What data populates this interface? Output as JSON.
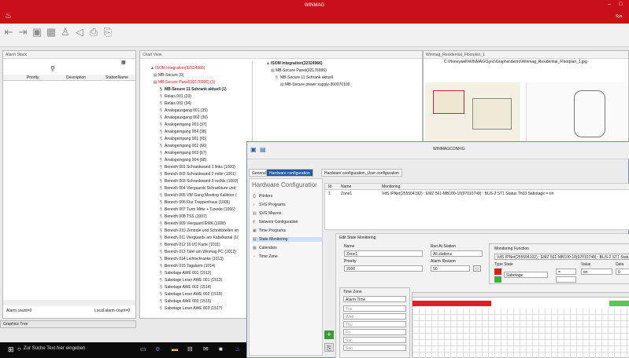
{
  "main": {
    "title": "WINMAG",
    "user": "Sys"
  },
  "alarm_stack": {
    "title": "Alarm Stack",
    "columns": [
      "Priority",
      "Description",
      "StationName"
    ],
    "status_left": "Alarm count=0",
    "status_right": "Local alarm count=0",
    "bottom_tab": "Graphics Tree"
  },
  "chart_view": {
    "title": "Chart View",
    "tree": [
      {
        "label": "ISOM Integration(32324966)",
        "style": "red"
      },
      {
        "label": "MB-Secure (0)",
        "style": ""
      },
      {
        "label": "MB-Secure Panel(93176996) (1)",
        "style": "red"
      },
      {
        "label": "MB-Secure 11 Schrank aktuell (1)",
        "style": "bold"
      },
      {
        "label": "Relais 001 (33)",
        "style": ""
      },
      {
        "label": "Relais 002 (34)",
        "style": ""
      },
      {
        "label": "Analogausgang 001 (35)",
        "style": ""
      },
      {
        "label": "Analogausgang 002 (36)",
        "style": ""
      },
      {
        "label": "Analogeingang 003 (37)",
        "style": ""
      },
      {
        "label": "Analogeingang 004 (38)",
        "style": ""
      },
      {
        "label": "Analogeingang 001 (65)",
        "style": ""
      },
      {
        "label": "Analogeingang 002 (66)",
        "style": ""
      },
      {
        "label": "Analogeingang 003 (67)",
        "style": ""
      },
      {
        "label": "Analogeingang 004 (68)",
        "style": ""
      },
      {
        "label": "Bereich 001 Schrankwand 1 links (1000)",
        "style": ""
      },
      {
        "label": "Bereich 002 Schrankwand 2 mitte (1001)",
        "style": ""
      },
      {
        "label": "Bereich 003 Schrankwand 3 rechts (1002)",
        "style": ""
      },
      {
        "label": "Bereich 004 Vierguards Schrankture und",
        "style": ""
      },
      {
        "label": "Bereich 005 VW Gang Meeting Kalibrier (",
        "style": ""
      },
      {
        "label": "Bereich 006 Flur Treppenhaus (1005)",
        "style": ""
      },
      {
        "label": "Bereich 007 Turm Mitte + Tuxedo (1006)",
        "style": ""
      },
      {
        "label": "Bereich 008 TSS (1007)",
        "style": ""
      },
      {
        "label": "Bereich 009 Vierguard EMK (1008)",
        "style": ""
      },
      {
        "label": "Bereich 010 Zentrale und Schnittstellen im",
        "style": ""
      },
      {
        "label": "Bereich 011 Vierguards am Kabelkanal (1(",
        "style": ""
      },
      {
        "label": "Bereich 012 16 I/O Karte (1011)",
        "style": ""
      },
      {
        "label": "Bereich 013 Tafel am Winmag PC (1012)",
        "style": ""
      },
      {
        "label": "Bereich 014 Lichtschranke (1013)",
        "style": ""
      },
      {
        "label": "Bereich 015 Tagalarm (1014)",
        "style": ""
      },
      {
        "label": "Sabotage AWE 001 (1512)",
        "style": ""
      },
      {
        "label": "Sabotage Leser AWE 001 (1513)",
        "style": ""
      },
      {
        "label": "Sabotage AWE 002 (1514)",
        "style": ""
      },
      {
        "label": "Sabotage Leser AWE 002 (1515)",
        "style": ""
      },
      {
        "label": "Sabotage AWE 003 (1516)",
        "style": ""
      },
      {
        "label": "Sabotage Leser AWE 003 (1517)",
        "style": ""
      },
      {
        "label": "Sabotage AWE 004 (1518)",
        "style": ""
      },
      {
        "label": "Sabotage Leser AWE 004 (1519)",
        "style": ""
      },
      {
        "label": "Sabotage AWE 005 (1520)",
        "style": ""
      }
    ]
  },
  "isom_panel": {
    "tree": [
      {
        "label": "ISOM Integration(32324966)",
        "style": "bold"
      },
      {
        "label": "MB-Secure Panel(93176996)",
        "style": ""
      },
      {
        "label": "MB-Secure 11 Schrank aktuell",
        "style": ""
      },
      {
        "label": "MB-Secure power supply-300070100",
        "style": ""
      }
    ]
  },
  "floorplan": {
    "title": "Winmag_Residential_Floorplan_1",
    "path": "C:\\Honeywell\\WINMAG\\Sync\\Graphic\\demo\\Winmag_Residential_Floorplan_1.jpg"
  },
  "taskbar": {
    "search": "Zur Suche Text hier eingeben"
  },
  "config": {
    "title": "WINMAGCONFIG",
    "tabs": [
      "General",
      "Hardware configuration",
      "Hardware configuration_User configuration"
    ],
    "heading": "Hardware Configuratior",
    "nav": [
      "Printers",
      "SVG Programs",
      "SVG Macros",
      "Network Configuration",
      "Time Programs",
      "State Monitoring",
      "Calendars",
      "Time Zone"
    ],
    "table_headers": [
      "Id",
      "Name",
      "Monitoring"
    ],
    "table_row": {
      "id": "1",
      "name": "Zone1",
      "monitoring": "VdS IPNet(255504192) : EMZ 561-MB100-10(97010749) : BUS-2 ST1 Status Th03 Sabotage = on"
    },
    "edit": {
      "title": "Edit State Monitoring",
      "name_label": "Name",
      "name_value": "Zone1",
      "run_label": "Run At Station",
      "run_value": "All stations",
      "priority_label": "Priority",
      "priority_value": "2000",
      "alarm_reason_label": "Alarm Reason",
      "alarm_reason_value": "50",
      "monitoring_function": "Monitoring Function",
      "monitoring_value": "VdS IPNet(255504192) : EMZ 561-MB100-10(97010749) : BUS-2 ST1 Status Th",
      "type_label": "Type",
      "state_label": "State",
      "value_label": "Value",
      "dela_label": "Dela",
      "state_select": "Sabotage",
      "op_select": "=",
      "val_select": "on",
      "dela_value": "0",
      "timezone_title": "Time Zone",
      "timezone_select": "Alarm Time",
      "days": [
        "Tue",
        "Wed",
        "Thu",
        "Fri",
        "Sat",
        "Sun",
        "Mon"
      ]
    }
  }
}
